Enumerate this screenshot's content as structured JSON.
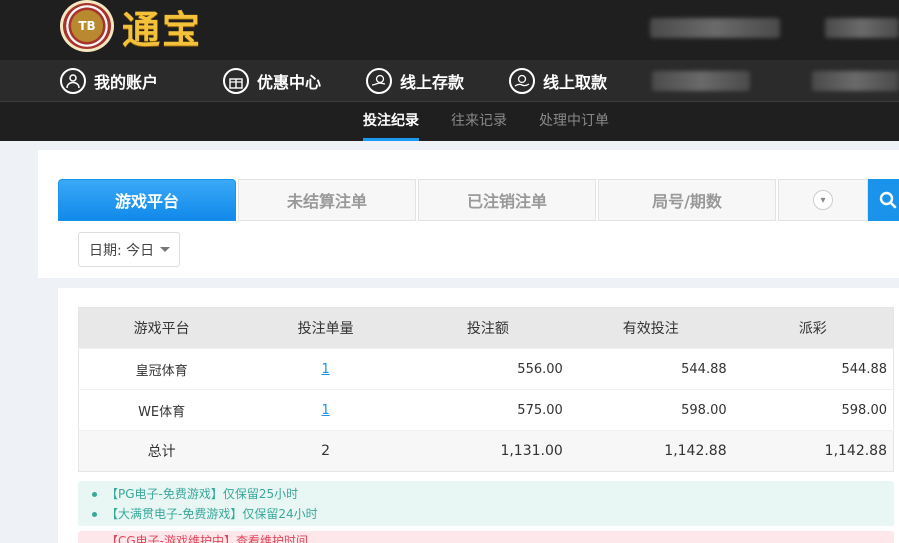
{
  "header": {
    "logo_badge": "TB",
    "logo_text": "通宝"
  },
  "nav": {
    "items": [
      {
        "label": "我的账户",
        "icon": "user-icon"
      },
      {
        "label": "优惠中心",
        "icon": "gift-icon"
      },
      {
        "label": "线上存款",
        "icon": "deposit-icon"
      },
      {
        "label": "线上取款",
        "icon": "withdraw-icon"
      }
    ]
  },
  "subnav": {
    "items": [
      "投注纪录",
      "往来记录",
      "处理中订单"
    ],
    "active": "投注纪录"
  },
  "tabs": {
    "items": [
      "游戏平台",
      "未结算注单",
      "已注销注单",
      "局号/期数"
    ],
    "active": "游戏平台"
  },
  "filter": {
    "date_label": "日期: 今日"
  },
  "table": {
    "headers": [
      "游戏平台",
      "投注单量",
      "投注额",
      "有效投注",
      "派彩"
    ],
    "rows": [
      {
        "platform": "皇冠体育",
        "count": "1",
        "amount": "556.00",
        "valid": "544.88",
        "payout": "544.88"
      },
      {
        "platform": "WE体育",
        "count": "1",
        "amount": "575.00",
        "valid": "598.00",
        "payout": "598.00"
      }
    ],
    "total": {
      "label": "总计",
      "count": "2",
      "amount": "1,131.00",
      "valid": "1,142.88",
      "payout": "1,142.88"
    }
  },
  "notices": {
    "green": [
      "【PG电子-免费游戏】仅保留25小时",
      "【大满贯电子-免费游戏】仅保留24小时"
    ],
    "pink": "【CG电子-游戏维护中】查看维护时间"
  },
  "colors": {
    "accent": "#1a93ea",
    "header_bg": "#1f1f1f",
    "logo_gold": "#f3c13a"
  }
}
